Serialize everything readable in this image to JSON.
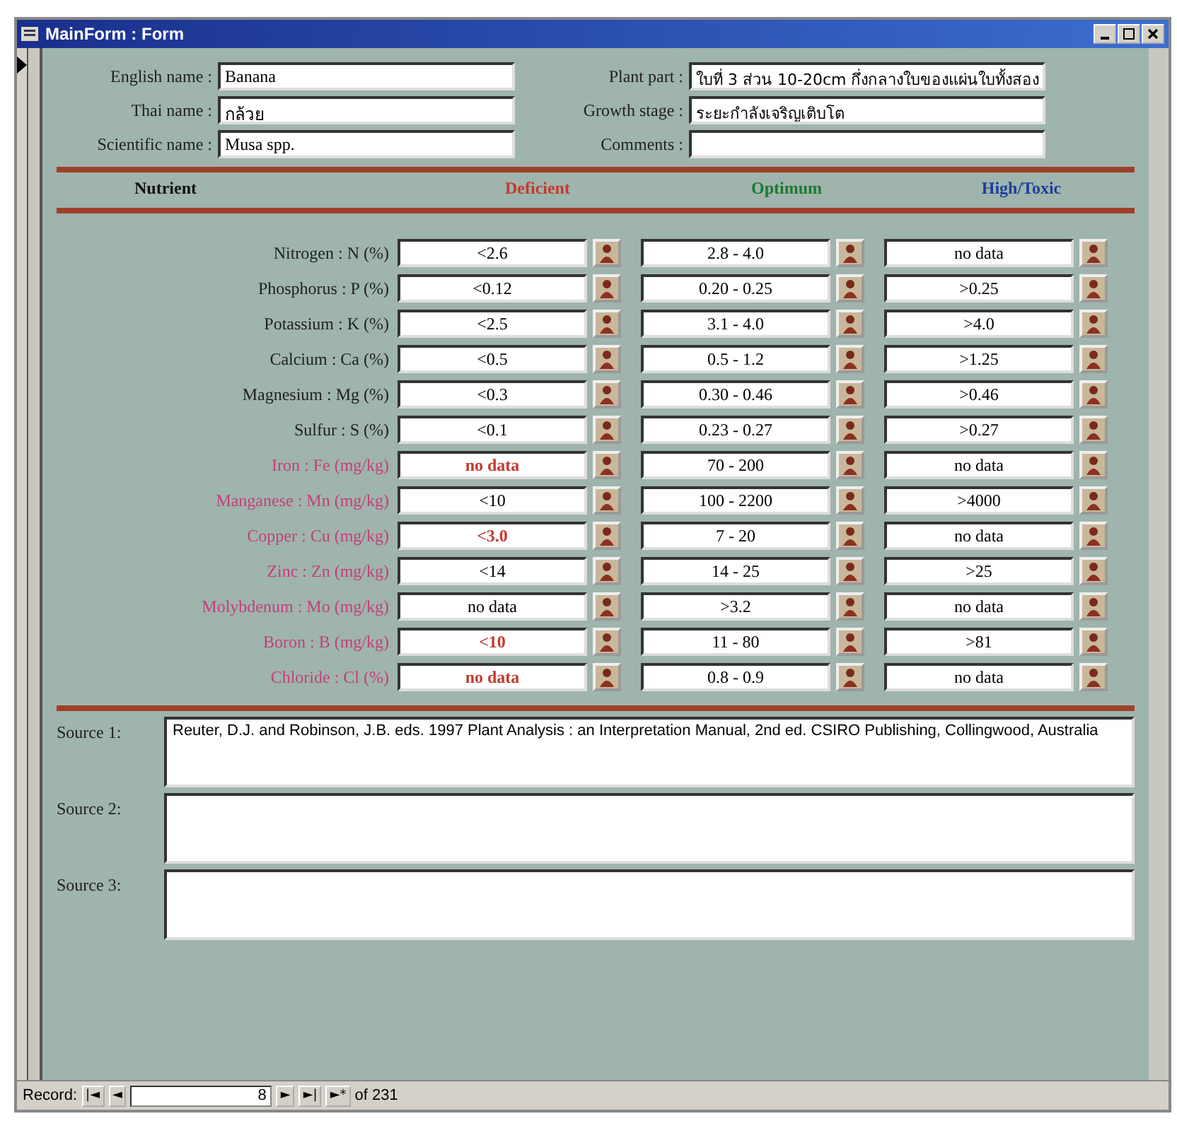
{
  "window": {
    "title": "MainForm : Form"
  },
  "fields_left": [
    {
      "label": "English name :",
      "value": "Banana"
    },
    {
      "label": "Thai name :",
      "value": "กล้วย"
    },
    {
      "label": "Scientific name :",
      "value": "Musa spp."
    }
  ],
  "fields_right": [
    {
      "label": "Plant part :",
      "value": "ใบที่ 3 ส่วน 10-20cm กึ่งกลางใบของแผ่นใบทั้งสอง"
    },
    {
      "label": "Growth stage :",
      "value": "ระยะกำลังเจริญเติบโต"
    },
    {
      "label": "Comments :"
    }
  ],
  "table": {
    "columns": [
      {
        "label": "Nutrient",
        "kind": "nutrient"
      },
      {
        "label": "Deficient",
        "kind": "deficient"
      },
      {
        "label": "Optimum",
        "kind": "optimum"
      },
      {
        "label": "High/Toxic",
        "kind": "high"
      }
    ],
    "rows": [
      {
        "nutrient": "Nitrogen : N (%)",
        "kind": "macro",
        "deficient": "<2.6",
        "flagged": false,
        "optimum": "2.8 - 4.0",
        "high": "no data"
      },
      {
        "nutrient": "Phosphorus : P (%)",
        "kind": "macro",
        "deficient": "<0.12",
        "flagged": false,
        "optimum": "0.20 - 0.25",
        "high": ">0.25"
      },
      {
        "nutrient": "Potassium : K (%)",
        "kind": "macro",
        "deficient": "<2.5",
        "flagged": false,
        "optimum": "3.1 - 4.0",
        "high": ">4.0"
      },
      {
        "nutrient": "Calcium : Ca (%)",
        "kind": "macro",
        "deficient": "<0.5",
        "flagged": false,
        "optimum": "0.5 - 1.2",
        "high": ">1.25"
      },
      {
        "nutrient": "Magnesium : Mg (%)",
        "kind": "macro",
        "deficient": "<0.3",
        "flagged": false,
        "optimum": "0.30 - 0.46",
        "high": ">0.46"
      },
      {
        "nutrient": "Sulfur : S (%)",
        "kind": "macro",
        "deficient": "<0.1",
        "flagged": false,
        "optimum": "0.23 - 0.27",
        "high": ">0.27"
      },
      {
        "nutrient": "Iron : Fe (mg/kg)",
        "kind": "micro",
        "deficient": "no data",
        "flagged": true,
        "optimum": "70 - 200",
        "high": "no data"
      },
      {
        "nutrient": "Manganese : Mn (mg/kg)",
        "kind": "micro",
        "deficient": "<10",
        "flagged": false,
        "optimum": "100 - 2200",
        "high": ">4000"
      },
      {
        "nutrient": "Copper : Cu (mg/kg)",
        "kind": "micro",
        "deficient": "<3.0",
        "flagged": true,
        "optimum": "7 - 20",
        "high": "no data"
      },
      {
        "nutrient": "Zinc : Zn (mg/kg)",
        "kind": "micro",
        "deficient": "<14",
        "flagged": false,
        "optimum": "14 - 25",
        "high": ">25"
      },
      {
        "nutrient": "Molybdenum : Mo (mg/kg)",
        "kind": "micro",
        "deficient": "no data",
        "flagged": false,
        "optimum": ">3.2",
        "high": "no data"
      },
      {
        "nutrient": "Boron : B (mg/kg)",
        "kind": "micro",
        "deficient": "<10",
        "flagged": true,
        "optimum": "11 - 80",
        "high": ">81"
      },
      {
        "nutrient": "Chloride : Cl (%)",
        "kind": "micro",
        "deficient": "no data",
        "flagged": true,
        "optimum": "0.8 - 0.9",
        "high": "no data"
      }
    ]
  },
  "sources": [
    {
      "label": "Source 1:",
      "value": "Reuter, D.J. and Robinson, J.B. eds. 1997 Plant Analysis : an Interpretation Manual, 2nd ed. CSIRO Publishing, Collingwood, Australia"
    },
    {
      "label": "Source 2:"
    },
    {
      "label": "Source 3:"
    }
  ],
  "navigation": {
    "label": "Record:",
    "first": "|◄",
    "prev": "◄",
    "current": "8",
    "next": "►",
    "last": "►|",
    "new": "►*",
    "total": "of 231"
  }
}
